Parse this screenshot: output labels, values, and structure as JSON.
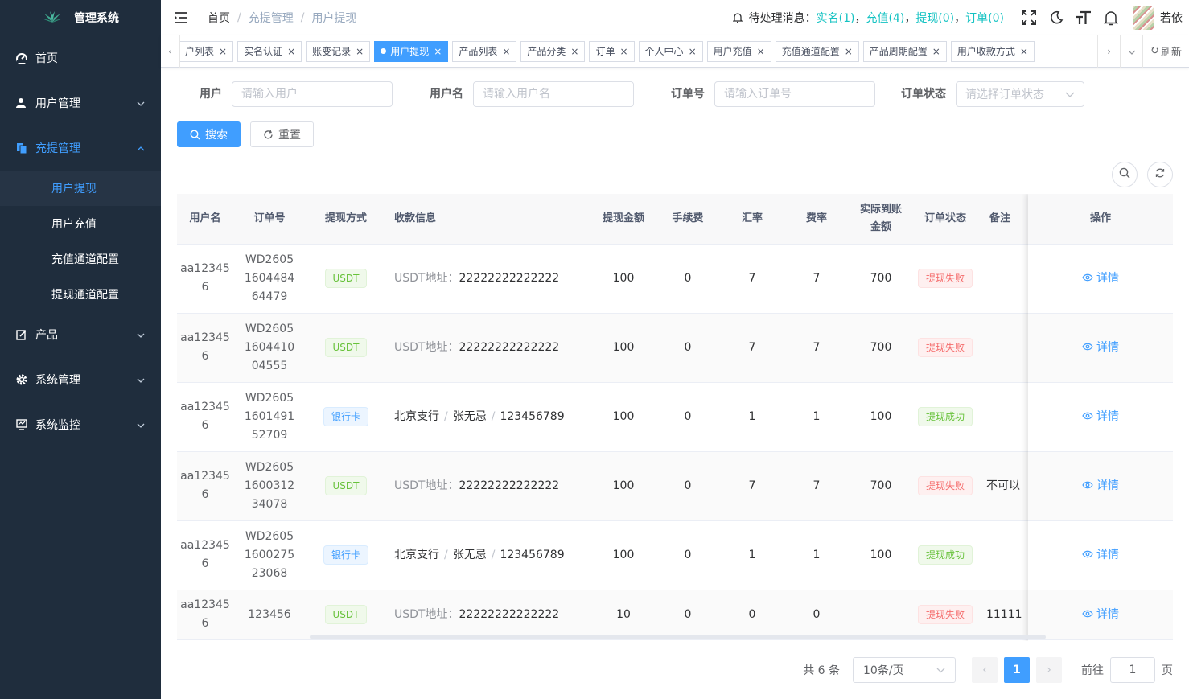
{
  "app_title": "管理系统",
  "sidebar": {
    "items": [
      {
        "label": "首页"
      },
      {
        "label": "用户管理"
      },
      {
        "label": "充提管理"
      },
      {
        "label": "产品"
      },
      {
        "label": "系统管理"
      },
      {
        "label": "系统监控"
      }
    ],
    "sub": [
      {
        "label": "用户提现"
      },
      {
        "label": "用户充值"
      },
      {
        "label": "充值通道配置"
      },
      {
        "label": "提现通道配置"
      }
    ]
  },
  "breadcrumb": {
    "home": "首页",
    "section": "充提管理",
    "current": "用户提现"
  },
  "header": {
    "pending_label": "待处理消息：",
    "pending_realname": "实名(1)",
    "pending_recharge": "充值(4)",
    "pending_withdraw": "提现(0)",
    "pending_order": "订单(0)",
    "comma": "，",
    "user_name": "若依"
  },
  "tags": [
    {
      "label": "户列表"
    },
    {
      "label": "实名认证"
    },
    {
      "label": "账变记录"
    },
    {
      "label": "用户提现"
    },
    {
      "label": "产品列表"
    },
    {
      "label": "产品分类"
    },
    {
      "label": "订单"
    },
    {
      "label": "个人中心"
    },
    {
      "label": "用户充值"
    },
    {
      "label": "充值通道配置"
    },
    {
      "label": "产品周期配置"
    },
    {
      "label": "用户收款方式"
    }
  ],
  "refresh_label": "刷新",
  "search_form": {
    "user_label": "用户",
    "user_placeholder": "请输入用户",
    "username_label": "用户名",
    "username_placeholder": "请输入用户名",
    "order_label": "订单号",
    "order_placeholder": "请输入订单号",
    "status_label": "订单状态",
    "status_placeholder": "请选择订单状态"
  },
  "buttons": {
    "search": "搜索",
    "reset": "重置"
  },
  "table": {
    "headers": {
      "username": "用户名",
      "order_no": "订单号",
      "method": "提现方式",
      "receipt": "收款信息",
      "amount": "提现金额",
      "fee": "手续费",
      "rate": "汇率",
      "fee_rate": "费率",
      "actual_1": "实际到账",
      "actual_2": "金额",
      "status": "订单状态",
      "remark": "备注",
      "ops": "操作"
    },
    "rows": [
      {
        "user_1": "aa12345",
        "user_2": "6",
        "order_1": "WD2605",
        "order_2": "1604484",
        "order_3": "64479",
        "method": "USDT",
        "addr_label": "USDT地址：",
        "addr": "22222222222222",
        "amount": "100",
        "fee": "0",
        "rate": "7",
        "fee_rate": "7",
        "actual": "700",
        "status": "提现失败",
        "remark": "",
        "op": "详情"
      },
      {
        "user_1": "aa12345",
        "user_2": "6",
        "order_1": "WD2605",
        "order_2": "1604410",
        "order_3": "04555",
        "method": "USDT",
        "addr_label": "USDT地址：",
        "addr": "22222222222222",
        "amount": "100",
        "fee": "0",
        "rate": "7",
        "fee_rate": "7",
        "actual": "700",
        "status": "提现失败",
        "remark": "",
        "op": "详情"
      },
      {
        "user_1": "aa12345",
        "user_2": "6",
        "order_1": "WD2605",
        "order_2": "1601491",
        "order_3": "52709",
        "method": "银行卡",
        "bank": "北京支行",
        "holder": "张无忌",
        "card": "123456789",
        "amount": "100",
        "fee": "0",
        "rate": "1",
        "fee_rate": "1",
        "actual": "100",
        "status": "提现成功",
        "remark": "",
        "op": "详情"
      },
      {
        "user_1": "aa12345",
        "user_2": "6",
        "order_1": "WD2605",
        "order_2": "1600312",
        "order_3": "34078",
        "method": "USDT",
        "addr_label": "USDT地址：",
        "addr": "22222222222222",
        "amount": "100",
        "fee": "0",
        "rate": "7",
        "fee_rate": "7",
        "actual": "700",
        "status": "提现失败",
        "remark": "不可以",
        "op": "详情"
      },
      {
        "user_1": "aa12345",
        "user_2": "6",
        "order_1": "WD2605",
        "order_2": "1600275",
        "order_3": "23068",
        "method": "银行卡",
        "bank": "北京支行",
        "holder": "张无忌",
        "card": "123456789",
        "amount": "100",
        "fee": "0",
        "rate": "1",
        "fee_rate": "1",
        "actual": "100",
        "status": "提现成功",
        "remark": "",
        "op": "详情"
      },
      {
        "user_1": "aa12345",
        "user_2": "6",
        "order": "123456",
        "method": "USDT",
        "addr_label": "USDT地址：",
        "addr": "22222222222222",
        "amount": "10",
        "fee": "0",
        "rate": "0",
        "fee_rate": "0",
        "actual": "",
        "status": "提现失败",
        "remark": "11111",
        "op": "详情"
      }
    ]
  },
  "pagination": {
    "total": "共 6 条",
    "page_size": "10条/页",
    "current_page": "1",
    "goto_label": "前往",
    "goto_value": "1",
    "page_unit": "页"
  },
  "colors": {
    "primary": "#409eff",
    "sidebar_bg": "#1f2d3d",
    "sidebar_active_bg": "#263445",
    "success": "#67c23a",
    "danger": "#f56c6c",
    "link_teal": "#13c2c2"
  }
}
